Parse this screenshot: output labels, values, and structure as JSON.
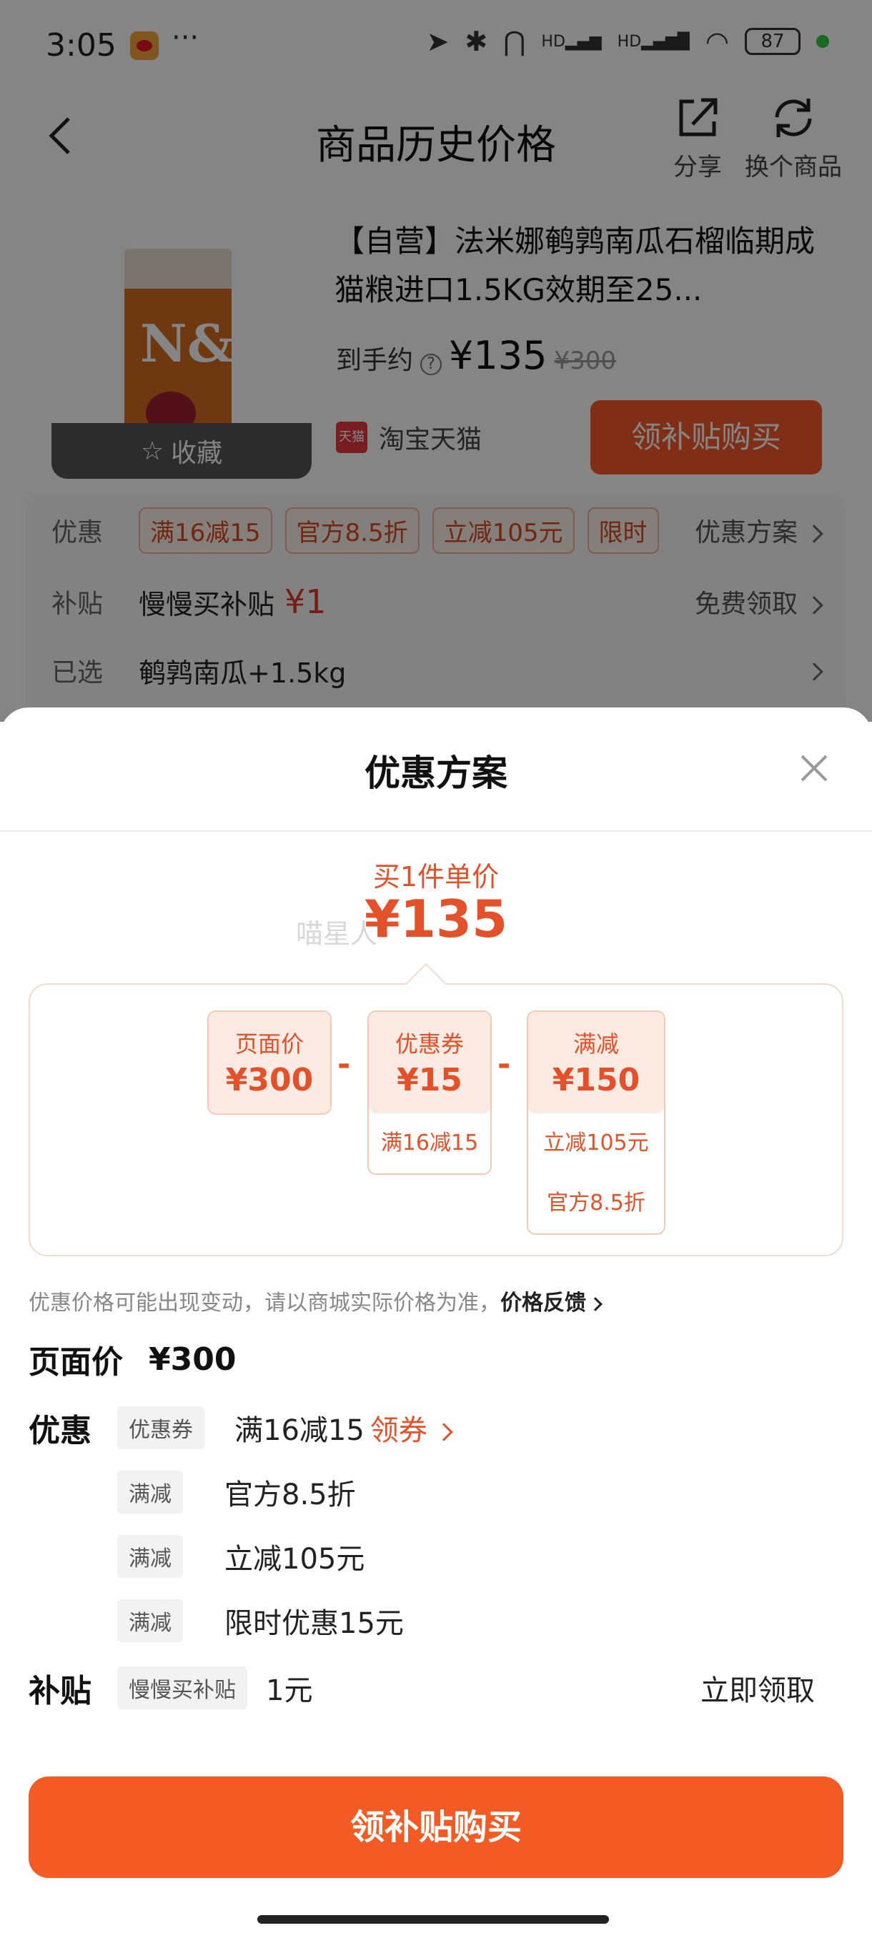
{
  "status_bar": {
    "time": "3:05",
    "dots": "···",
    "network_hd1": "HD",
    "network_hd2": "HD",
    "battery": "87"
  },
  "nav": {
    "title": "商品历史价格",
    "share_label": "分享",
    "change_label": "换个商品"
  },
  "product": {
    "name": "【自营】法米娜鹌鹑南瓜石榴临期成猫粮进口1.5KG效期至25...",
    "bag_logo": "N&D",
    "favorite_label": "收藏",
    "price_label": "到手约",
    "price_help": "?",
    "price": "¥135",
    "original_price": "¥300",
    "shop_badge": "天猫",
    "shop_name": "淘宝天猫",
    "buy_label": "领补贴购买"
  },
  "info": {
    "promo_key": "优惠",
    "promo_tags": [
      "满16减15",
      "官方8.5折",
      "立减105元",
      "限时"
    ],
    "promo_right": "优惠方案",
    "subsidy_key": "补贴",
    "subsidy_val": "慢慢买补贴",
    "subsidy_amount": "¥1",
    "subsidy_right": "免费领取",
    "selected_key": "已选",
    "selected_val": "鹌鹑南瓜+1.5kg"
  },
  "sheet": {
    "title": "优惠方案",
    "unit_label": "买1件单价",
    "unit_price": "¥135",
    "watermark": "喵星人",
    "cards": [
      {
        "label": "页面价",
        "value": "¥300",
        "subs": []
      },
      {
        "label": "优惠券",
        "value": "¥15",
        "subs": [
          "满16减15"
        ]
      },
      {
        "label": "满减",
        "value": "¥150",
        "subs": [
          "立减105元",
          "官方8.5折"
        ]
      }
    ],
    "minus": "-",
    "notice": "优惠价格可能出现变动，请以商城实际价格为准，",
    "notice_link": "价格反馈",
    "page_price_key": "页面价",
    "page_price_val": "¥300",
    "discount_key": "优惠",
    "discount_rows": [
      {
        "chip": "优惠券",
        "text": "满16减15",
        "link": "领券"
      },
      {
        "chip": "满减",
        "text": "官方8.5折"
      },
      {
        "chip": "满减",
        "text": "立减105元"
      },
      {
        "chip": "满减",
        "text": "限时优惠15元"
      }
    ],
    "subsidy_key": "补贴",
    "subsidy_chip": "慢慢买补贴",
    "subsidy_val": "1元",
    "subsidy_claim": "立即领取",
    "buy_label": "领补贴购买"
  },
  "colors": {
    "accent": "#f35a24",
    "price_red": "#e2512a",
    "overlay": "rgba(0,0,0,0.48)"
  }
}
